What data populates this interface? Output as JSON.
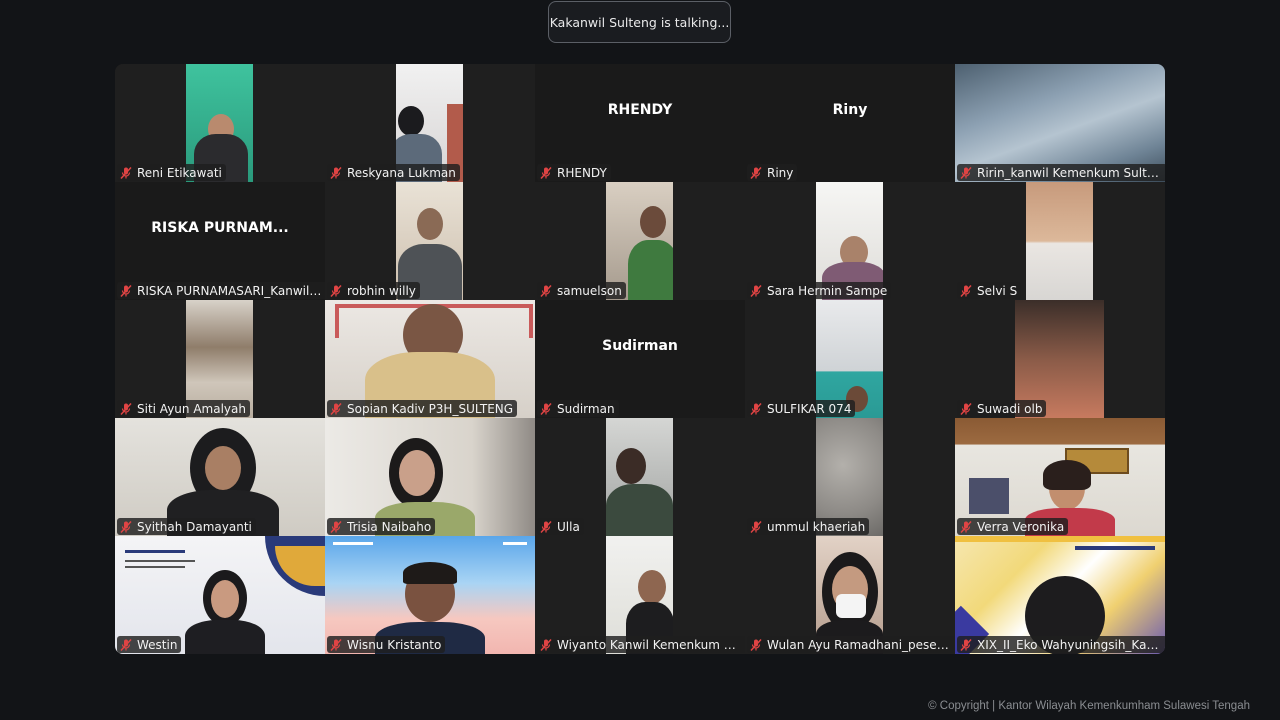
{
  "talking_indicator": "Kakanwil Sulteng is talking...",
  "copyright": "© Copyright | Kantor Wilayah Kemenkumham Sulawesi Tengah",
  "participants": [
    {
      "name": "Reni Etikawati"
    },
    {
      "name": "Reskyana Lukman"
    },
    {
      "name": "RHENDY",
      "initials": "RHENDY"
    },
    {
      "name": "Riny",
      "initials": "Riny"
    },
    {
      "name": "Ririn_kanwil Kemenkum Sulteng"
    },
    {
      "name": "RISKA PURNAMASARI_Kanwil Sul...",
      "initials": "RISKA  PURNAM..."
    },
    {
      "name": "robhin willy"
    },
    {
      "name": "samuelson"
    },
    {
      "name": "Sara Hermin Sampe"
    },
    {
      "name": "Selvi S"
    },
    {
      "name": "Siti Ayun Amalyah"
    },
    {
      "name": "Sopian Kadiv P3H_SULTENG"
    },
    {
      "name": "Sudirman",
      "initials": "Sudirman"
    },
    {
      "name": "SULFIKAR 074"
    },
    {
      "name": "Suwadi olb"
    },
    {
      "name": "Syithah Damayanti"
    },
    {
      "name": "Trisia Naibaho"
    },
    {
      "name": "Ulla"
    },
    {
      "name": "ummul khaeriah"
    },
    {
      "name": "Verra Veronika"
    },
    {
      "name": "Westin"
    },
    {
      "name": "Wisnu Kristanto"
    },
    {
      "name": "Wiyanto Kanwil Kemenkum Sulte..."
    },
    {
      "name": "Wulan Ayu Ramadhani_peserta ..."
    },
    {
      "name": "XIX_II_Eko Wahyuningsih_Kanwil ..."
    }
  ],
  "colors": {
    "muted_mic": "#e04444",
    "background": "#121417",
    "tile": "#1f1f1f"
  }
}
